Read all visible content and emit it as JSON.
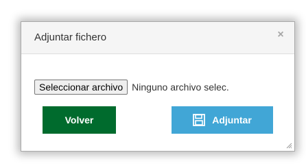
{
  "dialog": {
    "title": "Adjuntar fichero",
    "close_glyph": "×",
    "file_input": {
      "button_label": "Seleccionar archivo",
      "status_text": "Ninguno archivo selec."
    },
    "buttons": {
      "back_label": "Volver",
      "attach_label": "Adjuntar",
      "attach_icon": "floppy-disk-icon"
    }
  },
  "colors": {
    "back_button": "#006b2d",
    "attach_button": "#41a6d6",
    "title_bar": "#f5f5f5",
    "close_icon": "#a6a6a6"
  }
}
